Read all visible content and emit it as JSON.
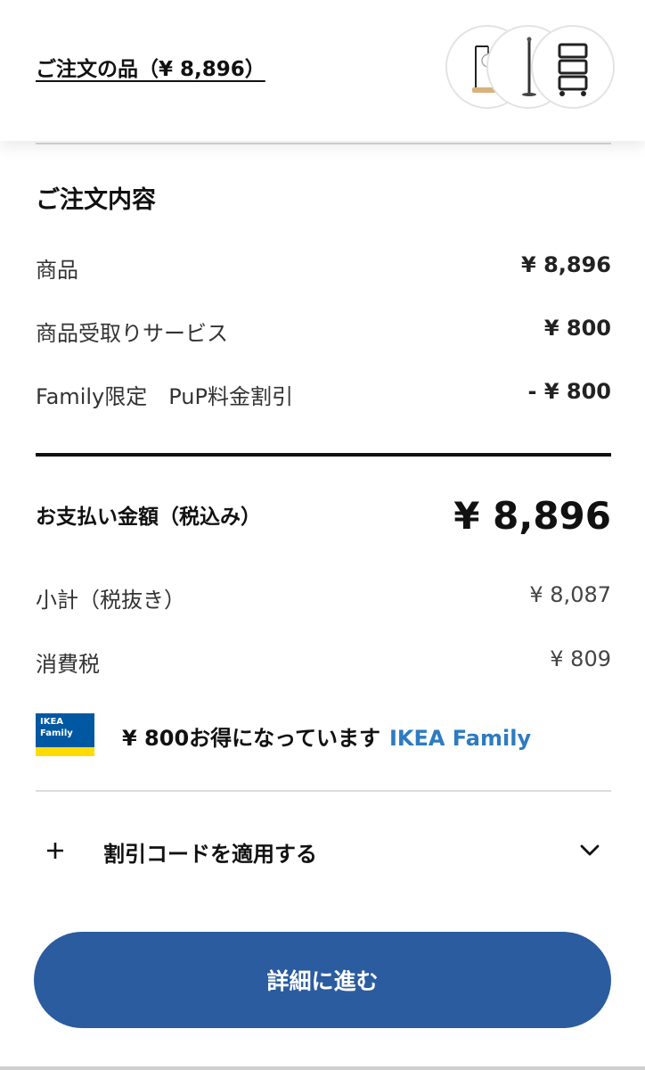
{
  "header": {
    "order_link": "ご注文の品（¥ 8,896）",
    "thumbnails": [
      {
        "icon": "table-lamp-icon"
      },
      {
        "icon": "floor-lamp-icon"
      },
      {
        "icon": "kitchen-trolley-icon"
      }
    ]
  },
  "summary": {
    "title": "ご注文内容",
    "rows": [
      {
        "label": "商品",
        "value": "¥ 8,896"
      },
      {
        "label": "商品受取りサービス",
        "value": "¥ 800"
      },
      {
        "label": "Family限定　PuP料金割引",
        "value": "- ¥ 800"
      }
    ],
    "total_label": "お支払い金額（税込み）",
    "total_value": "¥ 8,896",
    "breakdown": [
      {
        "label": "小計（税抜き）",
        "value": "¥ 8,087"
      },
      {
        "label": "消費税",
        "value": "¥ 809"
      }
    ]
  },
  "family": {
    "badge_line1": "IKEA",
    "badge_line2": "Family",
    "savings_text": "¥ 800お得になっています",
    "link_text": "IKEA Family",
    "badge_color": "#0058a3",
    "stripe_color": "#ffdb00",
    "link_color": "#2e7bc1"
  },
  "discount": {
    "label": "割引コードを適用する",
    "icon_left": "plus-icon",
    "icon_right": "chevron-down-icon"
  },
  "cta": {
    "label": "詳細に進む",
    "color": "#2a5c9f"
  }
}
